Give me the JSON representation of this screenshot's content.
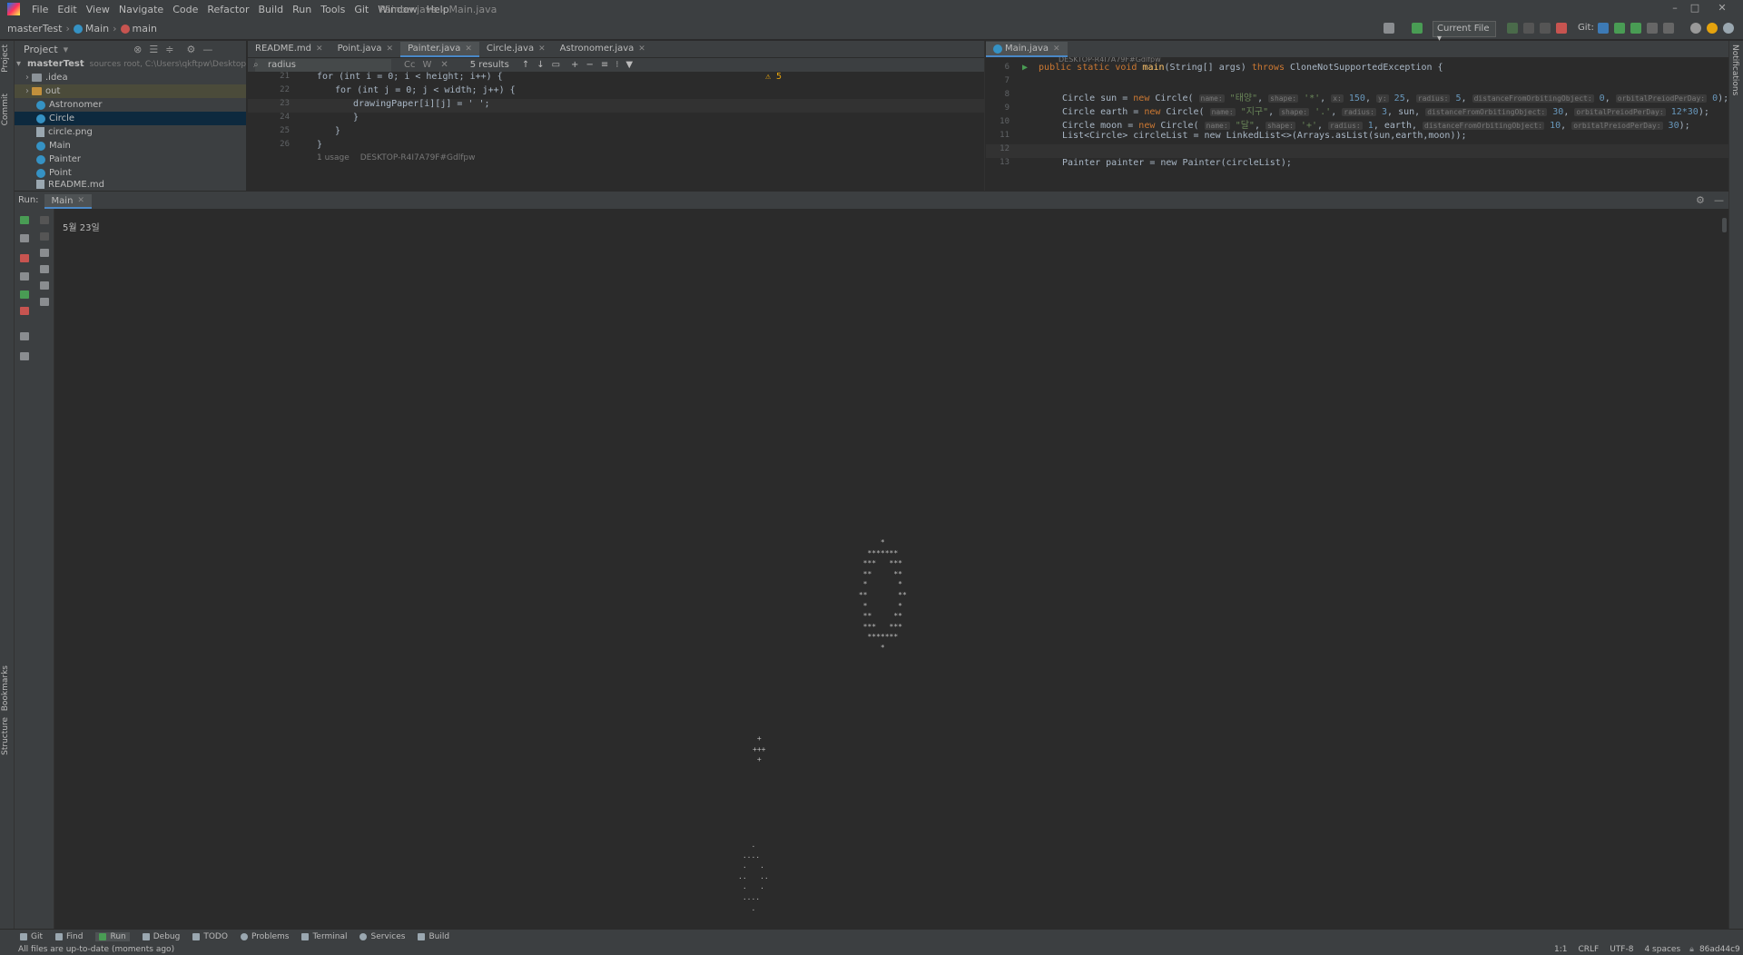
{
  "window": {
    "title": "Painter.java – Main.java",
    "menu": [
      "File",
      "Edit",
      "View",
      "Navigate",
      "Code",
      "Refactor",
      "Build",
      "Run",
      "Tools",
      "Git",
      "Window",
      "Help"
    ]
  },
  "navbar": {
    "project": "masterTest",
    "crumbs": [
      "Main",
      "main"
    ],
    "run_config": "Current File",
    "git_label": "Git:"
  },
  "project_panel": {
    "title": "Project",
    "items": [
      {
        "label": "masterTest",
        "note": "sources root, C:\\Users\\qkftpw\\Desktop\\ju"
      },
      {
        "label": ".idea"
      },
      {
        "label": "out"
      },
      {
        "label": "Astronomer"
      },
      {
        "label": "Circle"
      },
      {
        "label": "circle.png"
      },
      {
        "label": "Main"
      },
      {
        "label": "Painter"
      },
      {
        "label": "Point"
      },
      {
        "label": "README.md"
      }
    ]
  },
  "editor_left": {
    "tabs": [
      "README.md",
      "Point.java",
      "Painter.java",
      "Circle.java",
      "Astronomer.java"
    ],
    "search_value": "radius",
    "search_results": "5 results",
    "search_opts": [
      "Cc",
      "W"
    ],
    "warnings": "5",
    "lines": [
      {
        "num": "21",
        "code": "for (int i = 0; i < height; i++) {"
      },
      {
        "num": "22",
        "code": "for (int j = 0; j < width; j++) {"
      },
      {
        "num": "23",
        "code": "drawingPaper[i][j] = ' ';"
      },
      {
        "num": "24",
        "code": "}"
      },
      {
        "num": "25",
        "code": "}"
      },
      {
        "num": "26",
        "code": "}"
      },
      {
        "num": "27",
        "code": ""
      }
    ],
    "usage_hint": "1 usage",
    "author_hint": "DESKTOP-R4I7A79F#Gdlfpw"
  },
  "editor_right": {
    "tabs": [
      "Main.java"
    ],
    "author_hint": "DESKTOP-R4I7A79F#Gdlfpw",
    "lines": [
      {
        "num": "6",
        "type": "main",
        "code": "public static void main(String[] args) throws CloneNotSupportedException {"
      },
      {
        "num": "7",
        "type": "blank",
        "code": ""
      },
      {
        "num": "8",
        "type": "sun",
        "code": "Circle sun = new Circle("
      },
      {
        "num": "9",
        "type": "earth",
        "code": "Circle earth = new Circle("
      },
      {
        "num": "10",
        "type": "moon",
        "code": "Circle moon =  new Circle("
      },
      {
        "num": "11",
        "type": "list",
        "code": "List<Circle> circleList = new LinkedList<>(Arrays.asList(sun,earth,moon));"
      },
      {
        "num": "12",
        "type": "blank",
        "code": ""
      },
      {
        "num": "13",
        "type": "painter",
        "code": "Painter painter = new Painter(circleList);"
      }
    ],
    "sun": {
      "name": "\"태양\"",
      "shape": "'*'",
      "x": "150",
      "y": "25",
      "radius": "5",
      "dist": "0",
      "period": "0"
    },
    "earth": {
      "name": "\"지구\"",
      "shape": "'.'",
      "radius": "3",
      "orbit": "sun",
      "dist": "30",
      "period": "12*30"
    },
    "moon": {
      "name": "\"달\"",
      "shape": "'+'",
      "radius": "1",
      "orbit": "earth",
      "dist": "10",
      "period": "30"
    },
    "hint_labels": {
      "name": "name:",
      "shape": "shape:",
      "x": "x:",
      "y": "y:",
      "radius": "radius:",
      "dist": "distanceFromOrbitingObject:",
      "period": "orbitalPreiodPerDay:"
    }
  },
  "run_panel": {
    "label": "Run:",
    "tab": "Main",
    "date_line": "5월 23일",
    "sun_art": "      *\n   *******\n  ***   ***\n  **     **\n  *       *\n **       **\n  *       *\n  **     **\n  ***   ***\n   *******\n      *",
    "moon_art": " +\n+++\n +",
    "earth_art": "   .\n ....\n .   .\n..   ..\n .   .\n ....\n   ."
  },
  "bottom_tabs": [
    "Git",
    "Find",
    "Run",
    "Debug",
    "TODO",
    "Problems",
    "Terminal",
    "Services",
    "Build"
  ],
  "status": {
    "message": "All files are up-to-date (moments ago)",
    "position": "1:1",
    "line_sep": "CRLF",
    "encoding": "UTF-8",
    "indent": "4 spaces",
    "branch": "86ad44c9"
  },
  "stripe_labels": {
    "project": "Project",
    "commit": "Commit",
    "bookmarks": "Bookmarks",
    "structure": "Structure",
    "notifications": "Notifications"
  }
}
